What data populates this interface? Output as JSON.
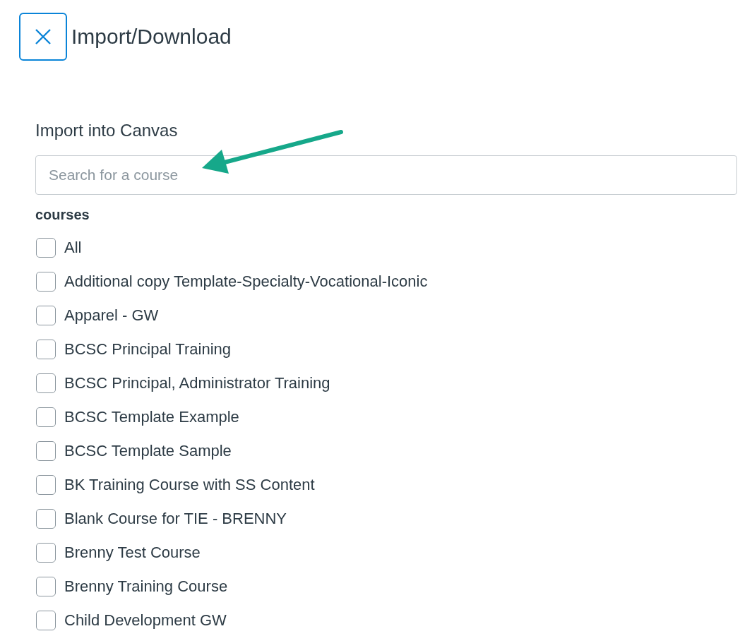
{
  "dialog": {
    "title": "Import/Download"
  },
  "import": {
    "heading": "Import into Canvas",
    "search": {
      "placeholder": "Search for a course"
    },
    "list_label": "courses",
    "courses": [
      {
        "label": "All",
        "checked": false
      },
      {
        "label": "Additional copy Template-Specialty-Vocational-Iconic",
        "checked": false
      },
      {
        "label": "Apparel - GW",
        "checked": false
      },
      {
        "label": "BCSC Principal Training",
        "checked": false
      },
      {
        "label": "BCSC Principal, Administrator Training",
        "checked": false
      },
      {
        "label": "BCSC Template Example",
        "checked": false
      },
      {
        "label": "BCSC Template Sample",
        "checked": false
      },
      {
        "label": "BK Training Course with SS Content",
        "checked": false
      },
      {
        "label": "Blank Course for TIE - BRENNY",
        "checked": false
      },
      {
        "label": "Brenny Test Course",
        "checked": false
      },
      {
        "label": "Brenny Training Course",
        "checked": false
      },
      {
        "label": "Child Development GW",
        "checked": false
      }
    ]
  }
}
